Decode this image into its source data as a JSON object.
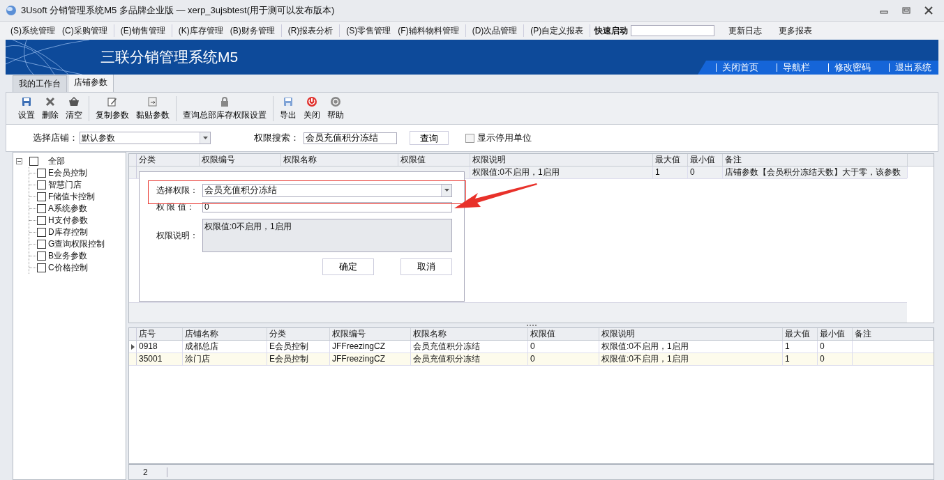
{
  "window": {
    "title": "3Usoft 分销管理系统M5 多品牌企业版 — xerp_3ujsbtest(用于测可以发布版本)"
  },
  "menu": {
    "groups": [
      [
        "(S)系统管理",
        "(C)采购管理"
      ],
      [
        "(E)销售管理"
      ],
      [
        "(K)库存管理",
        "(B)财务管理"
      ],
      [
        "(R)报表分析"
      ],
      [
        "(S)零售管理",
        "(F)辅料物料管理"
      ],
      [
        "(D)次品管理"
      ],
      [
        "(P)自定义报表"
      ]
    ],
    "quick_launch": {
      "label": "快速启动"
    },
    "links": [
      "更新日志",
      "更多报表"
    ]
  },
  "banner": {
    "title": "三联分销管理系统M5",
    "links": [
      "关闭首页",
      "导航栏",
      "修改密码",
      "退出系统"
    ]
  },
  "tabs": [
    {
      "label": "我的工作台",
      "selected": false
    },
    {
      "label": "店铺参数",
      "selected": true
    }
  ],
  "toolbar": {
    "groups": [
      [
        "设置",
        "删除",
        "清空"
      ],
      [
        "复制参数",
        "黏贴参数"
      ],
      [
        "查询总部库存权限设置"
      ],
      [
        "导出",
        "关闭",
        "帮助"
      ]
    ]
  },
  "filter": {
    "store_label": "选择店铺：",
    "store_value": "默认参数",
    "search_label": "权限搜索：",
    "search_value": "会员充值积分冻结",
    "search_button": "查询",
    "show_disabled": {
      "label": "显示停用单位",
      "checked": false
    }
  },
  "tree": {
    "label": "全部",
    "checked": false,
    "expanded": true,
    "children": [
      {
        "label": "E会员控制",
        "checked": false
      },
      {
        "label": "智慧门店",
        "checked": false
      },
      {
        "label": "F储值卡控制",
        "checked": false
      },
      {
        "label": "A系统参数",
        "checked": false
      },
      {
        "label": "H支付参数",
        "checked": false
      },
      {
        "label": "D库存控制",
        "checked": false
      },
      {
        "label": "G查询权限控制",
        "checked": false
      },
      {
        "label": "B业务参数",
        "checked": false
      },
      {
        "label": "C价格控制",
        "checked": false
      }
    ]
  },
  "upper_grid": {
    "columns": [
      "分类",
      "权限编号",
      "权限名称",
      "权限值",
      "权限说明",
      "最大值",
      "最小值",
      "备注"
    ],
    "visible_row": {
      "description": "权限值:0不启用，1启用",
      "max": "1",
      "min": "0",
      "note": "店铺参数【会员积分冻结天数】大于零，该参数"
    }
  },
  "dialog": {
    "select_label": "选择权限：",
    "select_value": "会员充值积分冻结",
    "value_label": "权 限 值：",
    "value": "0",
    "description_label": "权限说明：",
    "description": "权限值:0不启用，1启用",
    "ok": "确定",
    "cancel": "取消"
  },
  "lower_grid": {
    "columns": [
      "店号",
      "店铺名称",
      "分类",
      "权限编号",
      "权限名称",
      "权限值",
      "权限说明",
      "最大值",
      "最小值",
      "备注"
    ],
    "rows": [
      {
        "selected": true,
        "cells": [
          "0918",
          "成都总店",
          "E会员控制",
          "JFFreezingCZ",
          "会员充值积分冻结",
          "0",
          "权限值:0不启用，1启用",
          "1",
          "0"
        ]
      },
      {
        "selected": false,
        "cells": [
          "35001",
          "涂门店",
          "E会员控制",
          "JFFreezingCZ",
          "会员充值积分冻结",
          "0",
          "权限值:0不启用，1启用",
          "1",
          "0"
        ]
      }
    ]
  },
  "status_bar": {
    "count": "2"
  }
}
